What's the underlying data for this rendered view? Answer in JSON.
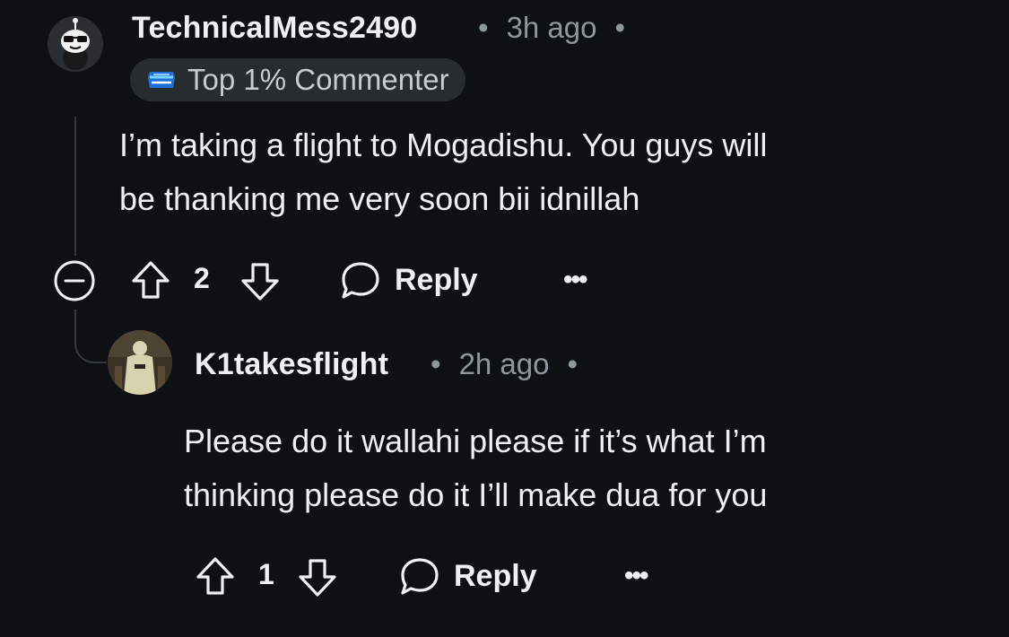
{
  "comments": [
    {
      "username": "TechnicalMess2490",
      "time": "3h ago",
      "flair": "Top 1% Commenter",
      "body_lines": [
        "I’m taking a flight to Mogadishu. You guys will",
        "be thanking me very soon bii idnillah"
      ],
      "votes": "2",
      "reply_label": "Reply",
      "more_label": "•••"
    },
    {
      "username": "K1takesflight",
      "time": "2h ago",
      "body_lines": [
        "Please do it wallahi please if it’s what I’m",
        "thinking please do it I’ll make dua for you"
      ],
      "votes": "1",
      "reply_label": "Reply",
      "more_label": "•••"
    }
  ],
  "separator": "•",
  "colors": {
    "background": "#0e1113",
    "text": "#eef1f3",
    "meta": "#8c979e",
    "thread_line": "#343a3e",
    "flair_bg": "#262c30"
  },
  "icons": [
    "snoo-avatar-icon",
    "top-commenter-badge-icon",
    "collapse-icon",
    "upvote-icon",
    "downvote-icon",
    "reply-bubble-icon",
    "more-options-icon"
  ]
}
